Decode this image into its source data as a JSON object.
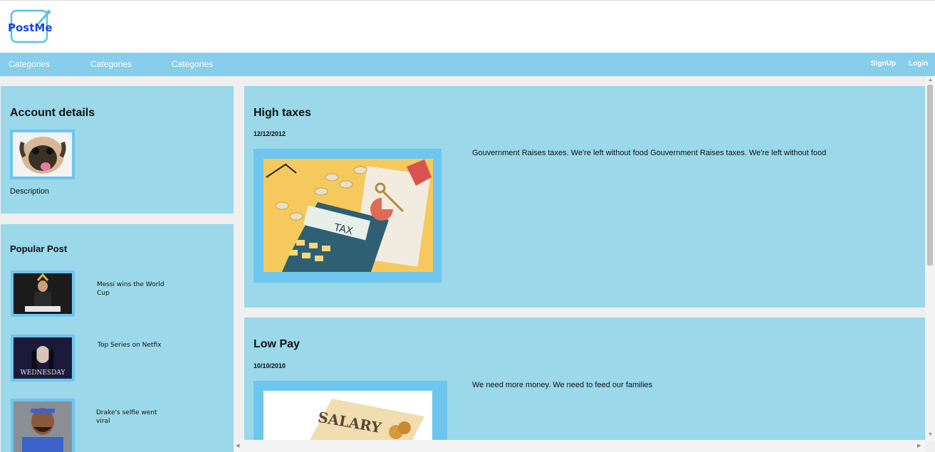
{
  "brand": {
    "logo_text": "PostMe"
  },
  "nav": {
    "items": [
      "Categories",
      "Categories",
      "Categories"
    ],
    "signup": "SignUp",
    "login": "Login"
  },
  "account": {
    "title": "Account details",
    "description": "Description"
  },
  "popular": {
    "title": "Popular Post",
    "posts": [
      {
        "title": "Messi wins the World Cup"
      },
      {
        "title": "Top Series on Netfix",
        "image_text": "WEDNESDAY"
      },
      {
        "title": "Drake's selfie went viral"
      }
    ]
  },
  "posts": [
    {
      "title": "High taxes",
      "date": "12/12/2012",
      "body": "Gouvernment Raises taxes. We're left without food Gouvernment Raises taxes. We're left without food",
      "image_text": "TAX"
    },
    {
      "title": "Low Pay",
      "date": "10/10/2010",
      "body": "We need more money. We need to feed our families",
      "image_text": "SALARY"
    }
  ],
  "colors": {
    "nav": "#87ceeb",
    "card": "#9ad8ea",
    "frame": "#6ec6ee",
    "logo_blue": "#1a44d6"
  }
}
